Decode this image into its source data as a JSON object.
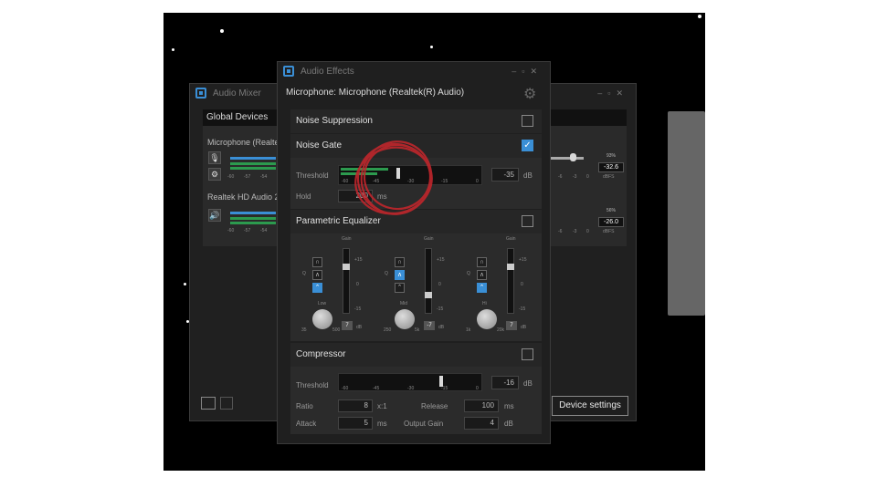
{
  "mixer": {
    "title": "Audio Mixer",
    "section": "Global Devices",
    "dev1": "Microphone (Realte",
    "dev2": "Realtek HD Audio 2",
    "ticks": [
      "-60",
      "-57",
      "-54"
    ],
    "r1_pct": "93%",
    "r1_db": "-32.6",
    "r2_pct": "56%",
    "r2_db": "-26.0",
    "rticks": [
      "-6",
      "-3",
      "0"
    ],
    "dbfs": "dBFS",
    "device_settings": "Device settings"
  },
  "effects": {
    "title": "Audio Effects",
    "source": "Microphone: Microphone (Realtek(R) Audio)",
    "noise_suppression": {
      "label": "Noise Suppression",
      "enabled": false
    },
    "noise_gate": {
      "label": "Noise Gate",
      "enabled": true,
      "threshold_label": "Threshold",
      "threshold": "-35",
      "threshold_unit": "dB",
      "threshold_fraction": 0.42,
      "ticks": [
        "-60",
        "-45",
        "-30",
        "-15",
        "0"
      ],
      "hold_label": "Hold",
      "hold": "200",
      "hold_unit": "ms"
    },
    "eq": {
      "label": "Parametric Equalizer",
      "enabled": false,
      "gain": "Gain",
      "q": "Q",
      "plus": "+15",
      "zero": "0",
      "minus": "-15",
      "db": "dB",
      "bands": [
        {
          "name": "Low",
          "min": "35",
          "max": "500",
          "value": "7",
          "gain_fraction": 0.75,
          "filter": 2
        },
        {
          "name": "Mid",
          "min": "250",
          "max": "5k",
          "value": "-7",
          "gain_fraction": 0.25,
          "filter": 1
        },
        {
          "name": "Hi",
          "min": "1k",
          "max": "20k",
          "value": "7",
          "gain_fraction": 0.75,
          "filter": 2
        }
      ]
    },
    "compressor": {
      "label": "Compressor",
      "enabled": false,
      "threshold_label": "Threshold",
      "threshold": "-16",
      "threshold_unit": "dB",
      "threshold_fraction": 0.73,
      "ticks": [
        "-60",
        "-45",
        "-30",
        "-15",
        "0"
      ],
      "ratio_label": "Ratio",
      "ratio": "8",
      "ratio_unit": "x:1",
      "release_label": "Release",
      "release": "100",
      "release_unit": "ms",
      "attack_label": "Attack",
      "attack": "5",
      "attack_unit": "ms",
      "output_gain_label": "Output Gain",
      "output_gain": "4",
      "output_gain_unit": "dB"
    }
  },
  "colors": {
    "accent": "#3a8fd6",
    "meter": "#2c9a4e",
    "annotation": "#c0262c"
  }
}
